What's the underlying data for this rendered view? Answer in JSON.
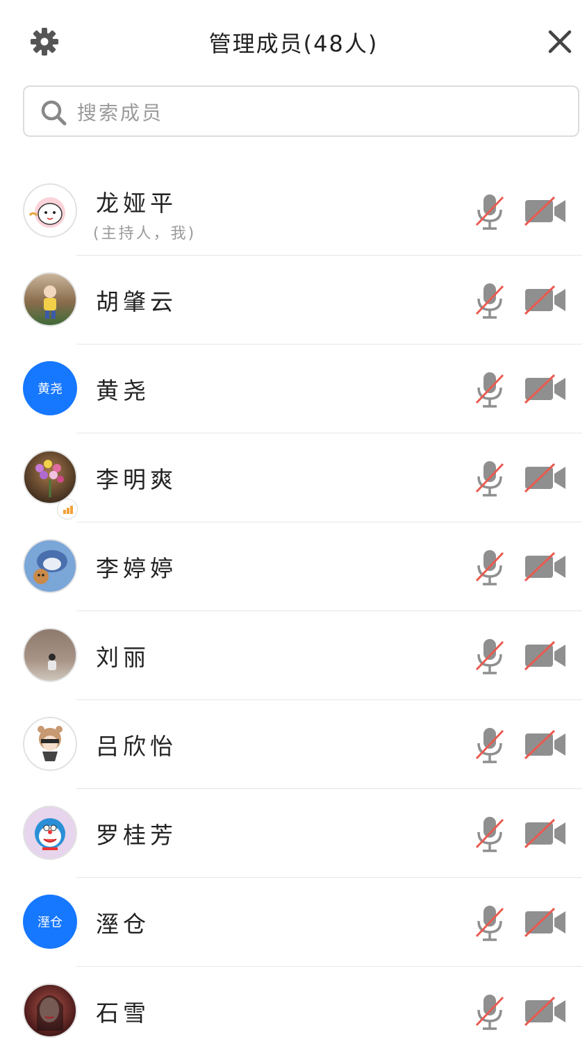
{
  "header": {
    "title": "管理成员(48人)"
  },
  "search": {
    "placeholder": "搜索成员"
  },
  "colors": {
    "accent": "#1677ff",
    "muted_icon": "#8f8f8f",
    "slash": "#ea5a4f"
  },
  "members": [
    {
      "name": "龙娅平",
      "sub": "(主持人，我)",
      "avatar": "image"
    },
    {
      "name": "胡肇云",
      "avatar": "image"
    },
    {
      "name": "黄尧",
      "avatar": "text",
      "avatar_text": "黄尧"
    },
    {
      "name": "李明爽",
      "avatar": "image"
    },
    {
      "name": "李婷婷",
      "avatar": "image"
    },
    {
      "name": "刘丽",
      "avatar": "image"
    },
    {
      "name": "吕欣怡",
      "avatar": "image"
    },
    {
      "name": "罗桂芳",
      "avatar": "image"
    },
    {
      "name": "溼仓",
      "avatar": "text",
      "avatar_text": "溼仓"
    },
    {
      "name": "石雪",
      "avatar": "image"
    }
  ]
}
